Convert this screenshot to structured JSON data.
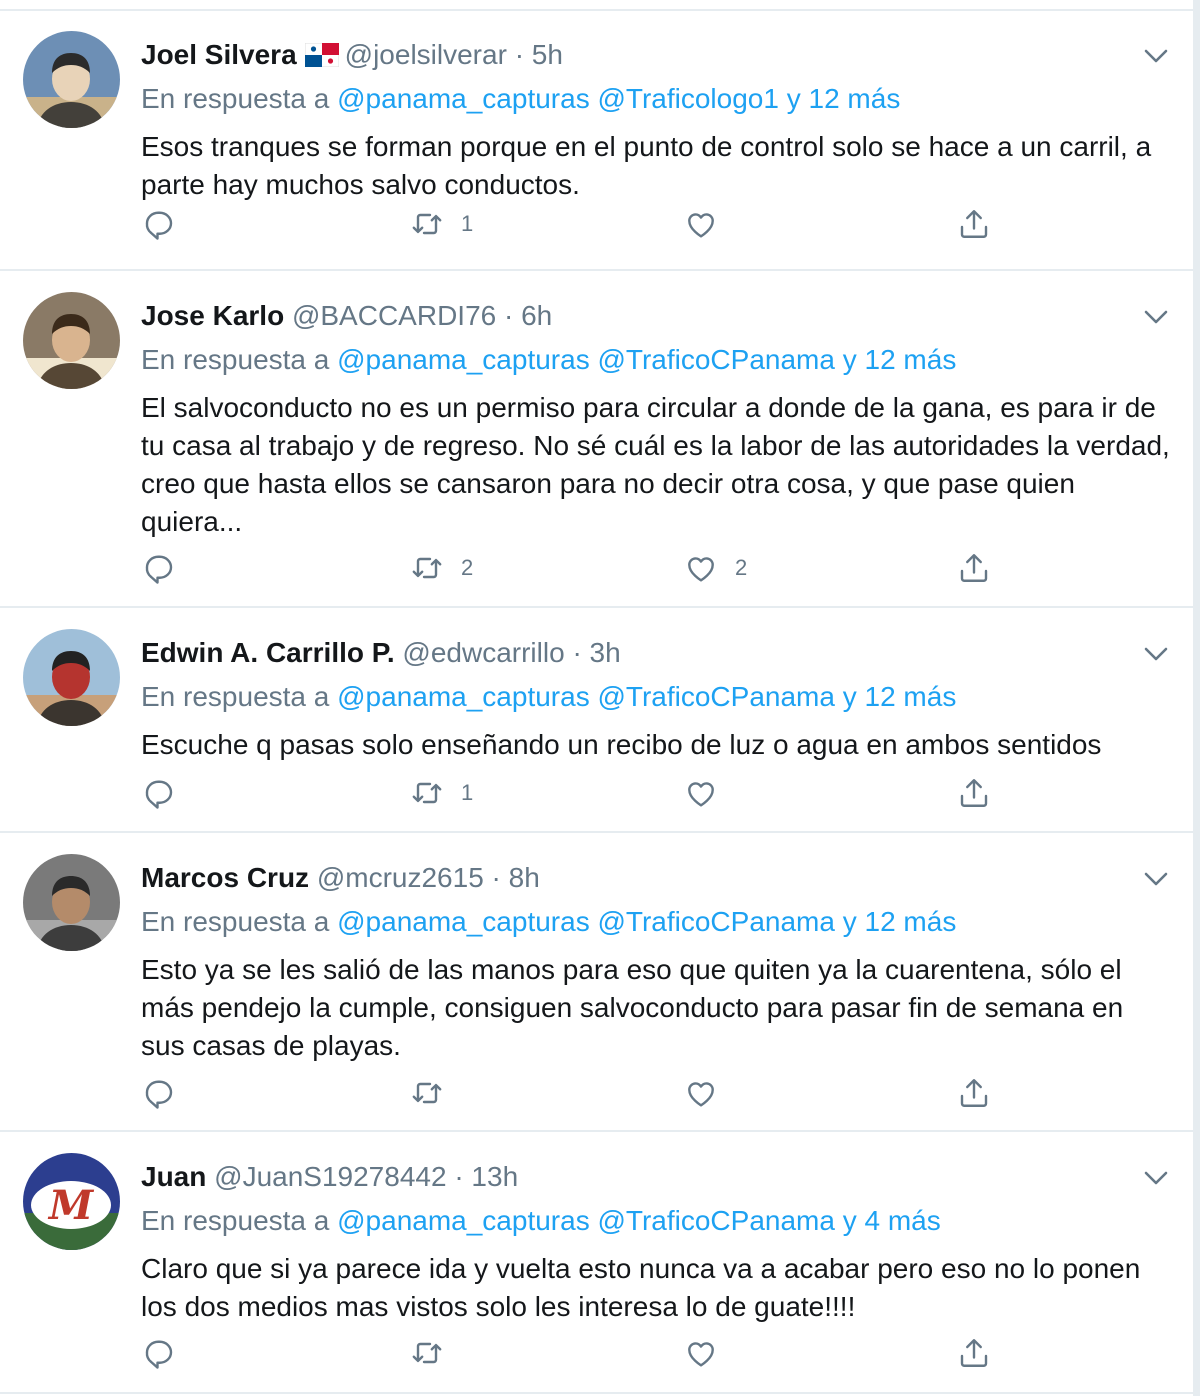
{
  "tweets": [
    {
      "name": "Joel Silvera",
      "handle": "@joelsilverar",
      "time": "· 5h",
      "has_flag": true,
      "reply_prefix": "En respuesta a",
      "reply_to": "@panama_capturas @Traficologo1 y 12 más",
      "text": "Esos tranques se forman porque en el punto de control solo se hace a un carril, a parte hay muchos salvo conductos.",
      "retweets": "1",
      "likes": "",
      "avatar_icon": "profile-photo"
    },
    {
      "name": "Jose Karlo",
      "handle": "@BACCARDI76",
      "time": "· 6h",
      "has_flag": false,
      "reply_prefix": "En respuesta a",
      "reply_to": "@panama_capturas @TraficoCPanama y 12 más",
      "text": "El salvoconducto no es un permiso para circular a donde de la gana, es para ir de tu casa al trabajo y de regreso. No sé cuál es la labor de las autoridades la verdad, creo que hasta ellos se cansaron para no decir otra cosa, y que pase quien quiera...",
      "retweets": "2",
      "likes": "2",
      "avatar_icon": "profile-photo"
    },
    {
      "name": "Edwin A. Carrillo P.",
      "handle": "@edwcarrillo",
      "time": "· 3h",
      "has_flag": false,
      "reply_prefix": "En respuesta a",
      "reply_to": "@panama_capturas @TraficoCPanama y 12 más",
      "text": "Escuche q pasas solo enseñando un recibo de luz o agua en ambos sentidos",
      "retweets": "1",
      "likes": "",
      "avatar_icon": "profile-photo"
    },
    {
      "name": "Marcos Cruz",
      "handle": "@mcruz2615",
      "time": "· 8h",
      "has_flag": false,
      "reply_prefix": "En respuesta a",
      "reply_to": "@panama_capturas @TraficoCPanama y 12 más",
      "text": "Esto ya se les salió de las manos para eso que quiten ya la cuarentena, sólo el más pendejo la cumple, consiguen salvoconducto para pasar fin de semana en sus casas de playas.",
      "retweets": "",
      "likes": "",
      "avatar_icon": "profile-photo"
    },
    {
      "name": "Juan",
      "handle": "@JuanS19278442",
      "time": "· 13h",
      "has_flag": false,
      "reply_prefix": "En respuesta a",
      "reply_to": "@panama_capturas @TraficoCPanama y 4 más",
      "text": "Claro que si ya parece ida y vuelta esto nunca va a acabar pero eso no lo ponen los dos medios mas vistos solo les interesa lo de guate!!!!",
      "retweets": "",
      "likes": "",
      "avatar_icon": "team-logo"
    }
  ],
  "colors": {
    "link": "#1da1f2",
    "meta": "#657786",
    "icon": "#657786",
    "divider": "#e6ecf0"
  }
}
